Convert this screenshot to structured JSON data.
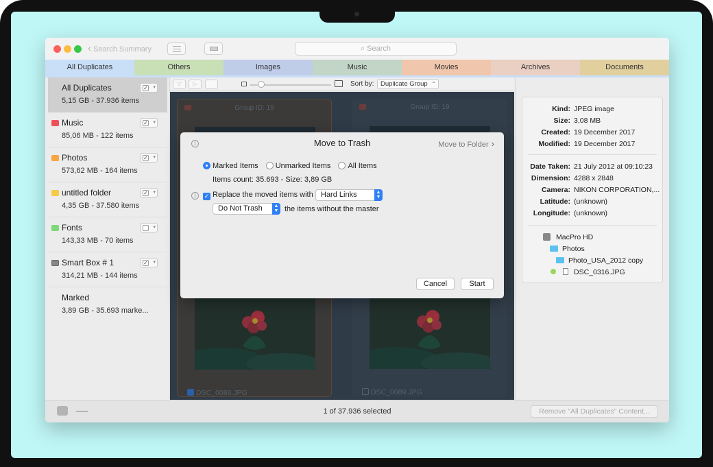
{
  "titlebar": {
    "back_label": "Search Summary",
    "search_placeholder": "Search"
  },
  "tabs": [
    {
      "label": "All Duplicates",
      "color": "#c9def7"
    },
    {
      "label": "Others",
      "color": "#c9dfb6"
    },
    {
      "label": "Images",
      "color": "#bfcde9"
    },
    {
      "label": "Music",
      "color": "#c2d5c6"
    },
    {
      "label": "Movies",
      "color": "#f0c7ac"
    },
    {
      "label": "Archives",
      "color": "#eacfc3"
    },
    {
      "label": "Documents",
      "color": "#e1cf9e"
    }
  ],
  "sidebar": {
    "items": [
      {
        "name": "All Duplicates",
        "info": "5,15 GB - 37.936 items",
        "checked": true,
        "icon_color": ""
      },
      {
        "name": "Music",
        "info": "85,06 MB - 122 items",
        "checked": true,
        "icon_color": "#f0505c"
      },
      {
        "name": "Photos",
        "info": "573,62 MB - 164 items",
        "checked": true,
        "icon_color": "#f5a742"
      },
      {
        "name": "untitled folder",
        "info": "4,35 GB - 37.580 items",
        "checked": true,
        "icon_color": "#f7c948"
      },
      {
        "name": "Fonts",
        "info": "143,33 MB - 70 items",
        "checked": false,
        "icon_color": "#7fd97b"
      },
      {
        "name": "Smart Box # 1",
        "info": "314,21 MB - 144 items",
        "checked": true,
        "icon_color": "#888888"
      },
      {
        "name": "Marked",
        "info": "3,89 GB - 35.693 marke..."
      }
    ]
  },
  "content_toolbar": {
    "sort_label": "Sort by:",
    "sort_value": "Duplicate Group"
  },
  "cards": [
    {
      "group": "Group ID: 19",
      "filename": "DSC_0089.JPG",
      "checked": true
    },
    {
      "group": "Group ID: 19",
      "filename": "DSC_0089.JPG",
      "checked": false
    }
  ],
  "info": {
    "rows": [
      {
        "k": "Kind:",
        "v": "JPEG image"
      },
      {
        "k": "Size:",
        "v": "3,08 MB"
      },
      {
        "k": "Created:",
        "v": "19 December 2017"
      },
      {
        "k": "Modified:",
        "v": "19 December 2017"
      },
      {
        "k": "Date Taken:",
        "v": "21 July 2012 at 09:10:23"
      },
      {
        "k": "Dimension:",
        "v": "4288 x 2848"
      },
      {
        "k": "Camera:",
        "v": "NIKON CORPORATION,..."
      },
      {
        "k": "Latitude:",
        "v": "(unknown)"
      },
      {
        "k": "Longitude:",
        "v": "(unknown)"
      }
    ],
    "path": [
      "MacPro HD",
      "Photos",
      "Photo_USA_2012 copy",
      "DSC_0316.JPG"
    ]
  },
  "status": {
    "selected_text": "1 of 37.936 selected",
    "remove_label": "Remove \"All Duplicates\" Content..."
  },
  "modal": {
    "title": "Move to Trash",
    "move_to_folder": "Move to Folder",
    "radio_marked": "Marked Items",
    "radio_unmarked": "Unmarked Items",
    "radio_all": "All Items",
    "count_line": "Items count: 35.693 - Size: 3,89 GB",
    "replace_label": "Replace the moved items with",
    "replace_value": "Hard Links",
    "trash_value": "Do Not Trash",
    "trash_suffix": "the items without the master",
    "cancel": "Cancel",
    "start": "Start"
  }
}
